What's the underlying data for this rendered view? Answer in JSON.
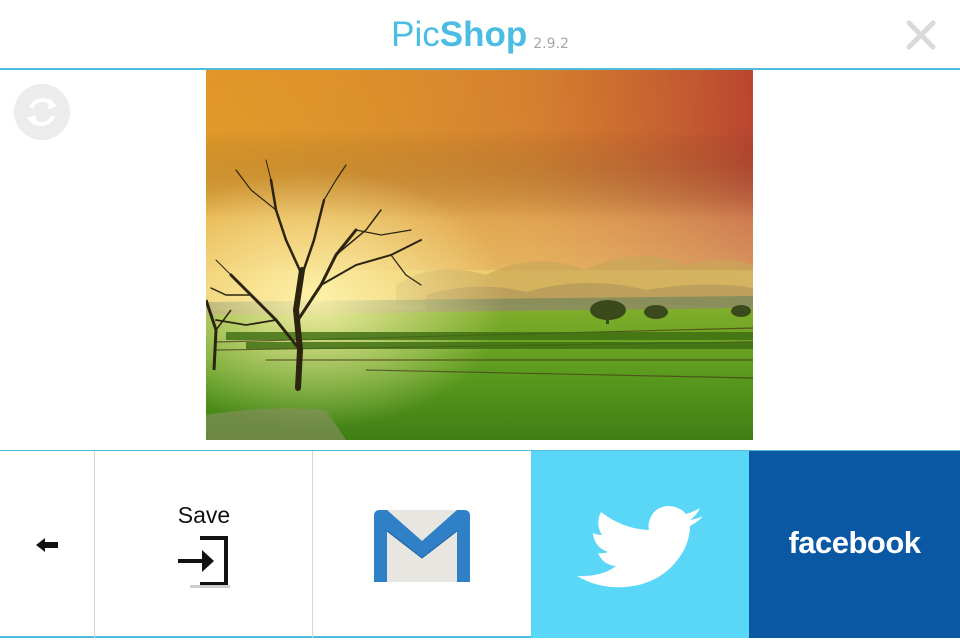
{
  "header": {
    "title_part1": "Pic",
    "title_part2": "Shop",
    "version": "2.9.2",
    "accent_color": "#4bbde2"
  },
  "icons": {
    "close": "close-icon",
    "rotate": "rotate-icon",
    "back": "arrow-left-icon",
    "save": "sign-in-icon",
    "gmail": "gmail-icon",
    "twitter": "twitter-bird-icon"
  },
  "share_bar": {
    "save_label": "Save",
    "facebook_label": "facebook",
    "twitter_color": "#5ad6f7",
    "facebook_color": "#0a58a3"
  }
}
